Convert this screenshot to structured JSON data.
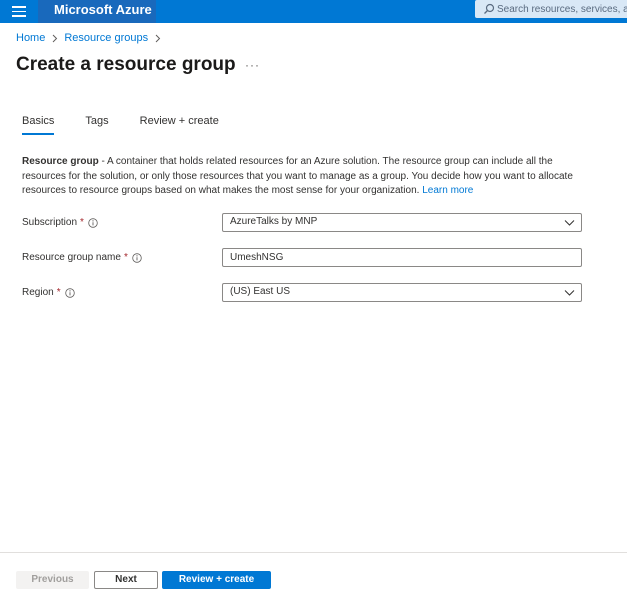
{
  "header": {
    "brand": "Microsoft Azure",
    "search_placeholder": "Search resources, services, and docs (G+/)",
    "menu_icon": "hamburger-menu-icon",
    "search_icon": "search-icon",
    "colors": {
      "topbar": "#0078d4",
      "brand_bg": "#1969bc"
    }
  },
  "breadcrumb": {
    "items": [
      "Home",
      "Resource groups"
    ]
  },
  "page": {
    "title": "Create a resource group",
    "more": "···"
  },
  "tabs": [
    {
      "label": "Basics",
      "active": true
    },
    {
      "label": "Tags",
      "active": false
    },
    {
      "label": "Review + create",
      "active": false
    }
  ],
  "description": {
    "bold": "Resource group",
    "text": " - A container that holds related resources for an Azure solution. The resource group can include all the resources for the solution, or only those resources that you want to manage as a group. You decide how you want to allocate resources to resource groups based on what makes the most sense for your organization. ",
    "link": "Learn more"
  },
  "form": {
    "subscription": {
      "label": "Subscription",
      "required": "*",
      "value": "AzureTalks by MNP"
    },
    "resource_group_name": {
      "label": "Resource group name",
      "required": "*",
      "value": "UmeshNSG"
    },
    "region": {
      "label": "Region",
      "required": "*",
      "value": "(US) East US"
    }
  },
  "footer": {
    "previous": "Previous",
    "next": "Next",
    "review_create": "Review + create"
  }
}
